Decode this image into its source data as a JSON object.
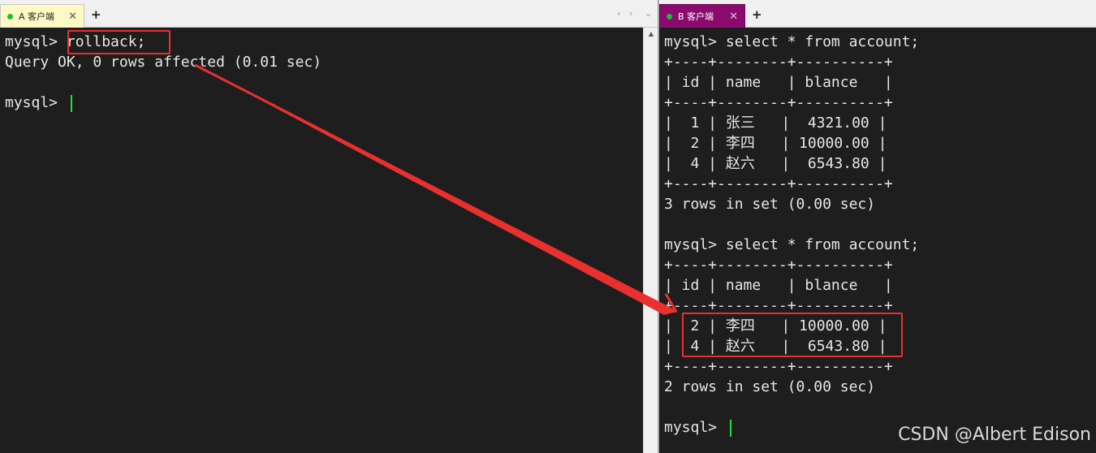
{
  "pane_a": {
    "tab": {
      "title": "A 客户端",
      "close": "✕"
    },
    "new_tab": "+",
    "nav": {
      "prev": "‹",
      "next": "›",
      "menu": "⌄"
    },
    "lines": [
      "mysql> rollback;",
      "Query OK, 0 rows affected (0.01 sec)",
      "",
      "mysql> "
    ]
  },
  "pane_b": {
    "tab": {
      "title": "B 客户端",
      "close": "✕"
    },
    "new_tab": "+",
    "lines": [
      "mysql> select * from account;",
      "+----+--------+----------+",
      "| id | name   | blance   |",
      "+----+--------+----------+",
      "|  1 | 张三   |  4321.00 |",
      "|  2 | 李四   | 10000.00 |",
      "|  4 | 赵六   |  6543.80 |",
      "+----+--------+----------+",
      "3 rows in set (0.00 sec)",
      "",
      "mysql> select * from account;",
      "+----+--------+----------+",
      "| id | name   | blance   |",
      "+----+--------+----------+",
      "|  2 | 李四   | 10000.00 |",
      "|  4 | 赵六   |  6543.80 |",
      "+----+--------+----------+",
      "2 rows in set (0.00 sec)",
      "",
      "mysql> "
    ]
  },
  "annotation_color": "#e8312f",
  "cursor_color": "#23e03c",
  "tab_b_color": "#8b0a6e",
  "watermark": "CSDN @Albert Edison"
}
